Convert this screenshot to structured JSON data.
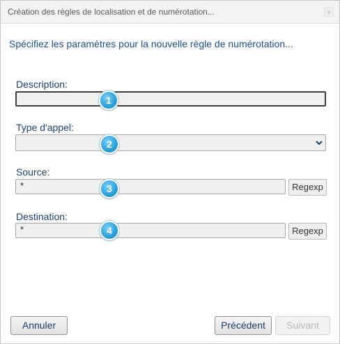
{
  "window": {
    "title": "Création des règles de localisation et de numérotation...",
    "close_label": "x"
  },
  "subtitle": "Spécifiez les paramètres pour la nouvelle règle de numérotation...",
  "fields": {
    "description": {
      "label": "Description:",
      "value": "",
      "badge": "1"
    },
    "call_type": {
      "label": "Type d'appel:",
      "value": "",
      "badge": "2"
    },
    "source": {
      "label": "Source:",
      "value": "*",
      "badge": "3",
      "regexp_label": "Regexp"
    },
    "destination": {
      "label": "Destination:",
      "value": "*",
      "badge": "4",
      "regexp_label": "Regexp"
    }
  },
  "buttons": {
    "cancel": "Annuler",
    "previous": "Précédent",
    "next": "Suivant"
  },
  "colors": {
    "label_text": "#1b3f6a",
    "subtitle_text": "#1e4f8c",
    "badge": "#2ea3dd"
  }
}
